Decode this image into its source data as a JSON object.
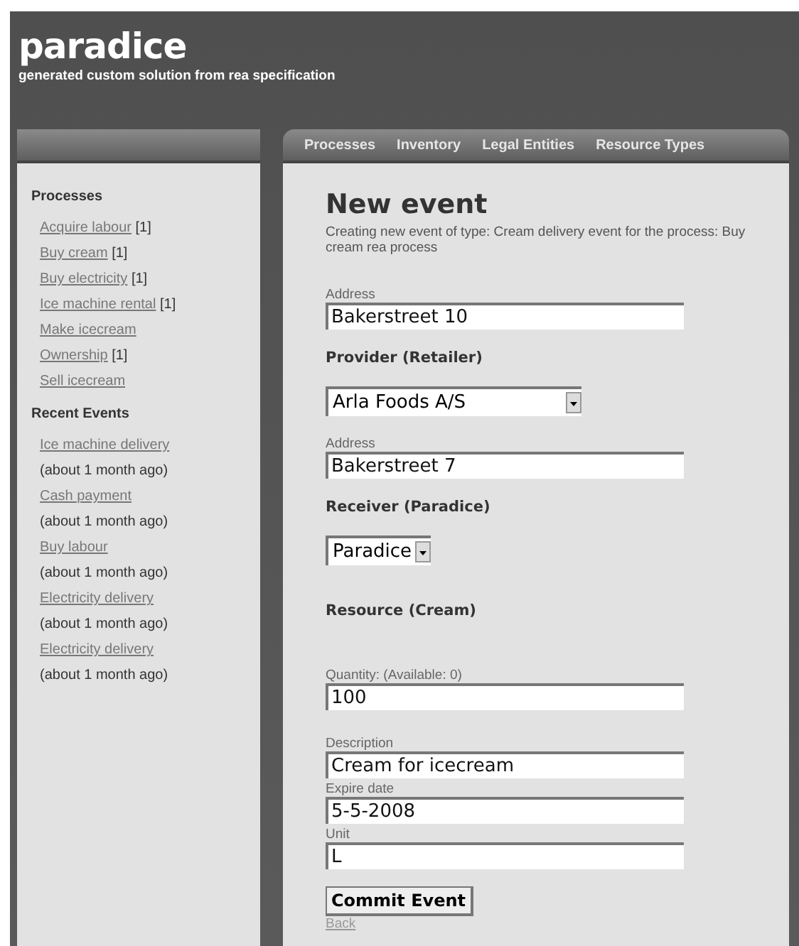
{
  "header": {
    "title": "paradice",
    "subtitle": "generated custom solution from rea specification"
  },
  "nav": [
    "Processes",
    "Inventory",
    "Legal Entities",
    "Resource Types"
  ],
  "sidebar": {
    "sections": [
      {
        "title": "Processes",
        "kind": "processes",
        "items": [
          {
            "link": "Acquire labour",
            "count": "[1]"
          },
          {
            "link": "Buy cream",
            "count": "[1]"
          },
          {
            "link": "Buy electricity",
            "count": "[1]"
          },
          {
            "link": "Ice machine rental",
            "count": "[1]"
          },
          {
            "link": "Make icecream"
          },
          {
            "link": "Ownership",
            "count": "[1]"
          },
          {
            "link": "Sell icecream"
          }
        ]
      },
      {
        "title": "Recent Events",
        "kind": "events",
        "items": [
          {
            "link": "Ice machine delivery",
            "time": "(about 1 month ago)"
          },
          {
            "link": "Cash payment",
            "time": "(about 1 month ago)"
          },
          {
            "link": "Buy labour",
            "time": "(about 1 month ago)"
          },
          {
            "link": "Electricity delivery",
            "time": "(about 1 month ago)"
          },
          {
            "link": "Electricity delivery",
            "time": "(about 1 month ago)"
          }
        ]
      }
    ]
  },
  "main": {
    "title": "New event",
    "description": "Creating new event of type: Cream delivery event for the process: Buy cream rea process",
    "form": [
      {
        "kind": "field",
        "label": "Address",
        "value": "Bakerstreet 10"
      },
      {
        "kind": "heading",
        "text": "Provider (Retailer)"
      },
      {
        "kind": "select",
        "value": "Arla Foods A/S"
      },
      {
        "kind": "field",
        "label": "Address",
        "value": "Bakerstreet 7"
      },
      {
        "kind": "heading",
        "text": "Receiver (Paradice)"
      },
      {
        "kind": "select",
        "value": "Paradice"
      },
      {
        "kind": "heading",
        "text": "Resource (Cream)"
      },
      {
        "kind": "field",
        "label": "Quantity: (Available: 0)",
        "value": "100"
      },
      {
        "kind": "field",
        "label": "Description",
        "value": "Cream for icecream"
      },
      {
        "kind": "field",
        "label": "Expire date",
        "value": "5-5-2008"
      },
      {
        "kind": "field",
        "label": "Unit",
        "value": "L"
      }
    ],
    "submit": "Commit Event",
    "back": "Back"
  }
}
